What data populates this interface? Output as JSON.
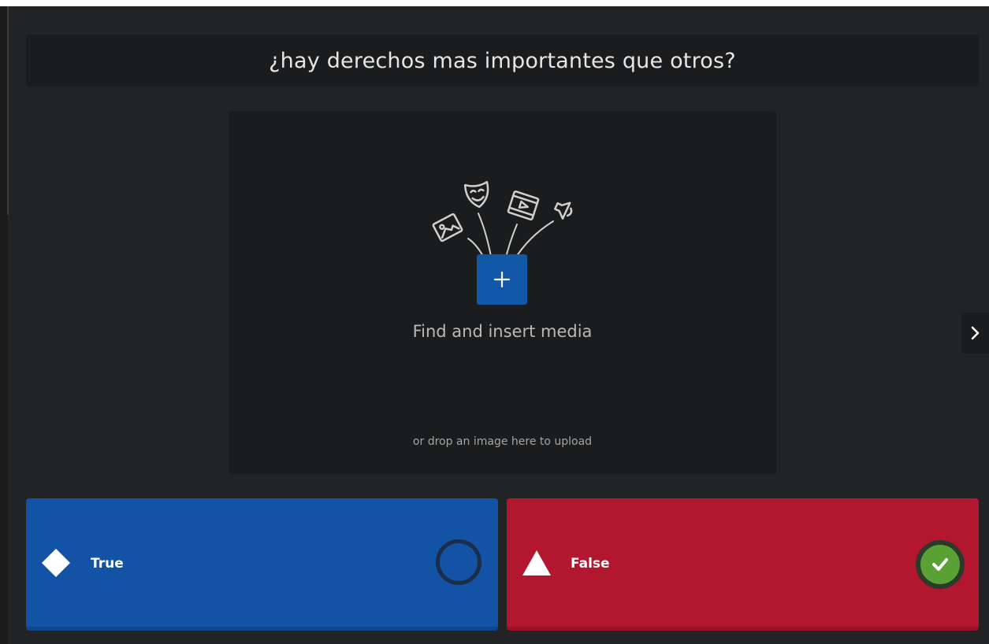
{
  "question": {
    "text": "¿hay derechos mas importantes que otros?"
  },
  "media": {
    "title": "Find and insert media",
    "subtitle": "or drop an image here to upload"
  },
  "answers": [
    {
      "label": "True",
      "shape": "diamond-icon",
      "color": "#1253a5",
      "correct": false
    },
    {
      "label": "False",
      "shape": "triangle-icon",
      "color": "#b3172f",
      "correct": true
    }
  ]
}
